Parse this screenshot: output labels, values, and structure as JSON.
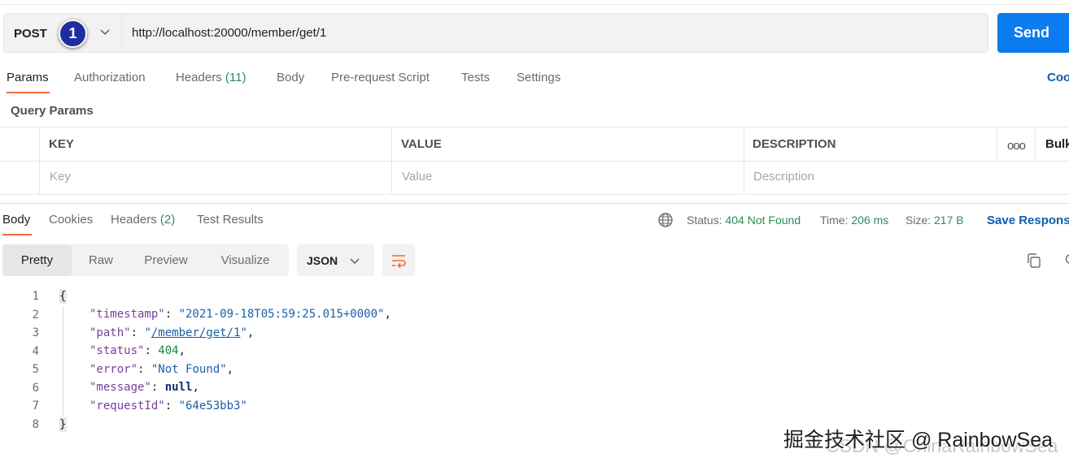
{
  "request": {
    "method": "POST",
    "step_badge": "1",
    "url": "http://localhost:20000/member/get/1",
    "send_label": "Send"
  },
  "request_tabs": {
    "params": "Params",
    "authorization": "Authorization",
    "headers": "Headers",
    "headers_count": "(11)",
    "body": "Body",
    "prerequest": "Pre-request Script",
    "tests": "Tests",
    "settings": "Settings",
    "code": "Coo"
  },
  "query_params": {
    "title": "Query Params",
    "columns": {
      "key": "KEY",
      "value": "VALUE",
      "description": "DESCRIPTION"
    },
    "placeholders": {
      "key": "Key",
      "value": "Value",
      "description": "Description"
    },
    "more": "ooo",
    "bulk_edit": "Bulk"
  },
  "response": {
    "tabs": {
      "body": "Body",
      "cookies": "Cookies",
      "headers": "Headers",
      "headers_count": "(2)",
      "test_results": "Test Results"
    },
    "status_label": "Status:",
    "status_value": "404 Not Found",
    "time_label": "Time:",
    "time_value": "206 ms",
    "size_label": "Size:",
    "size_value": "217 B",
    "save_label": "Save Respons",
    "views": [
      "Pretty",
      "Raw",
      "Preview",
      "Visualize"
    ],
    "active_view": "Pretty",
    "format": "JSON"
  },
  "code": {
    "line_numbers": [
      "1",
      "2",
      "3",
      "4",
      "5",
      "6",
      "7",
      "8"
    ],
    "open_brace": "{",
    "close_brace": "}",
    "keys": {
      "timestamp": "\"timestamp\"",
      "path": "\"path\"",
      "status": "\"status\"",
      "error": "\"error\"",
      "message": "\"message\"",
      "requestId": "\"requestId\""
    },
    "values": {
      "timestamp": "\"2021-09-18T05:59:25.015+0000\"",
      "path": "/member/get/1",
      "status": "404",
      "error": "\"Not Found\"",
      "message": "null",
      "requestId": "\"64e53bb3\""
    }
  },
  "watermark": {
    "primary": "掘金技术社区 @ RainbowSea",
    "secondary": "CSDN @ChinaRainbowSea"
  },
  "colors": {
    "accent_send": "#0b7cef",
    "tab_underline": "#f26b3a",
    "badge": "#1f2e9e",
    "status_ok_text": "#2e8b57"
  }
}
